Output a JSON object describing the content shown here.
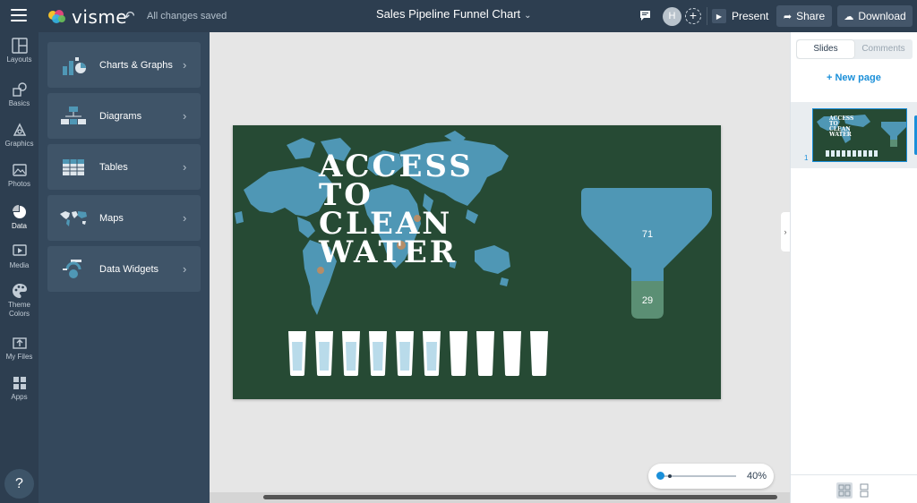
{
  "app": {
    "logo_text": "visme",
    "save_status": "All changes saved",
    "document_title": "Sales Pipeline Funnel Chart",
    "user_initial": "H",
    "present_label": "Present",
    "share_label": "Share",
    "download_label": "Download"
  },
  "rail": {
    "items": [
      {
        "label": "Layouts",
        "icon": "layouts-icon"
      },
      {
        "label": "Basics",
        "icon": "basics-icon"
      },
      {
        "label": "Graphics",
        "icon": "graphics-icon"
      },
      {
        "label": "Photos",
        "icon": "photos-icon"
      },
      {
        "label": "Data",
        "icon": "data-icon",
        "active": true
      },
      {
        "label": "Media",
        "icon": "media-icon"
      },
      {
        "label": "Theme Colors",
        "icon": "palette-icon"
      },
      {
        "label": "My Files",
        "icon": "upload-icon"
      },
      {
        "label": "Apps",
        "icon": "apps-icon"
      }
    ],
    "help_label": "?"
  },
  "panel": {
    "items": [
      {
        "label": "Charts & Graphs",
        "icon": "charts-icon"
      },
      {
        "label": "Diagrams",
        "icon": "diagrams-icon"
      },
      {
        "label": "Tables",
        "icon": "tables-icon"
      },
      {
        "label": "Maps",
        "icon": "maps-icon"
      },
      {
        "label": "Data Widgets",
        "icon": "data-widgets-icon"
      }
    ]
  },
  "slide": {
    "title_lines": [
      "ACCESS",
      "TO",
      "CLEAN",
      "WATER"
    ],
    "funnel": {
      "top_value": "71",
      "bottom_value": "29",
      "top_color": "#4f97b5",
      "bottom_color": "#5b8f74"
    },
    "glasses": {
      "count": 10,
      "filled": 6
    },
    "background_color": "#264a34",
    "map_color": "#4f97b5"
  },
  "zoom": {
    "label": "40%",
    "level": 0.05
  },
  "right_panel": {
    "tab_slides": "Slides",
    "tab_comments": "Comments",
    "new_page_label": "+ New page",
    "thumbnail_number": "1"
  },
  "colors": {
    "topbar": "#2d3e50",
    "accent": "#1a8fd9"
  }
}
